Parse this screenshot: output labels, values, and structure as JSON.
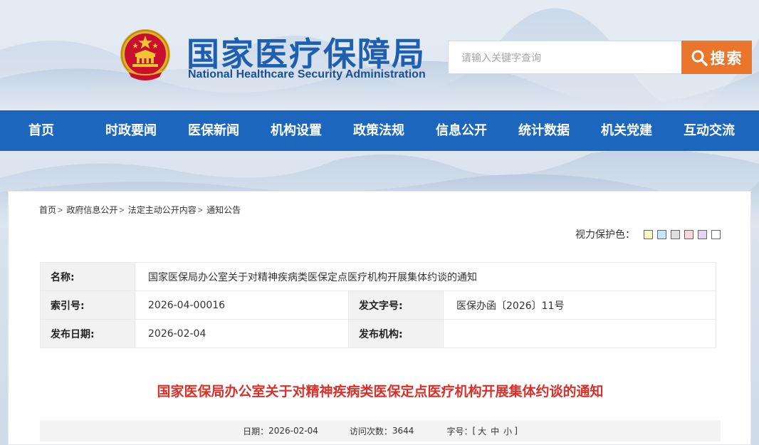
{
  "header": {
    "title_cn": "国家医疗保障局",
    "title_en": "National Healthcare Security Administration",
    "emblem_icon": "national-emblem-icon"
  },
  "search": {
    "placeholder": "请输入关键字查询",
    "button_label": "搜索",
    "button_color": "#e9762b"
  },
  "nav": {
    "color": "#1c66bd",
    "items": [
      "首页",
      "时政要闻",
      "医保新闻",
      "机构设置",
      "政策法规",
      "信息公开",
      "统计数据",
      "机关党建",
      "互动交流"
    ]
  },
  "breadcrumb": {
    "items": [
      "首页",
      "政府信息公开",
      "法定主动公开内容",
      "通知公告"
    ],
    "separator": ">"
  },
  "eye_protection": {
    "label": "视力保护色：",
    "swatches": [
      "#fbf7c0",
      "#c6e6f7",
      "#dedede",
      "#f7d7e0",
      "#e4d3f3",
      "#ffffff"
    ]
  },
  "info": {
    "name_label": "名称:",
    "name_value": "国家医保局办公室关于对精神疾病类医保定点医疗机构开展集体约谈的通知",
    "index_label": "索引号:",
    "index_value": "2026-04-00016",
    "docno_label": "发文字号:",
    "docno_value": "医保办函〔2026〕11号",
    "date_label": "发布日期:",
    "date_value": "2026-02-04",
    "org_label": "发布机构:",
    "org_value": ""
  },
  "document": {
    "title": "国家医保局办公室关于对精神疾病类医保定点医疗机构开展集体约谈的通知",
    "title_color": "#d8312b"
  },
  "meta": {
    "date_label": "日期：",
    "date_value": "2026-02-04",
    "visits_label": "访问次数：",
    "visits_value": "3644",
    "font_label": "字号：",
    "bracket_open": "[",
    "size_large": "大",
    "size_medium": "中",
    "size_small": "小",
    "bracket_close": "]"
  }
}
